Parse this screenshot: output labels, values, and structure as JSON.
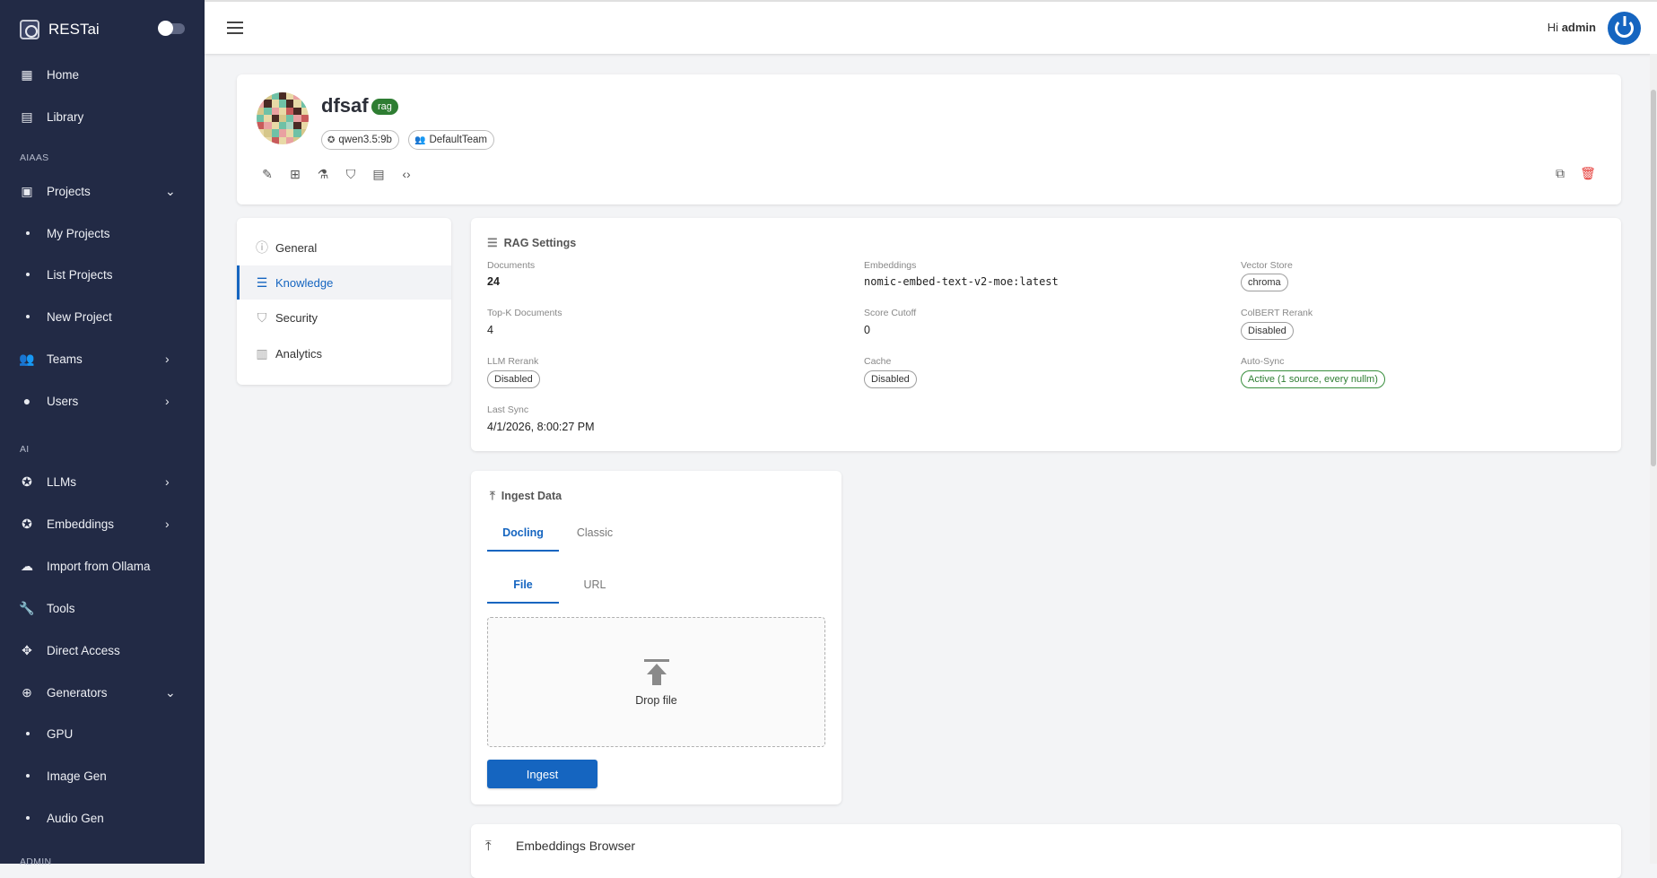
{
  "app": {
    "name": "RESTai"
  },
  "sidebar": {
    "items": [
      {
        "label": "Home",
        "icon": "dashboard-icon"
      },
      {
        "label": "Library",
        "icon": "library-icon"
      }
    ],
    "sections": {
      "aiaas": "AIAAS",
      "ai": "AI",
      "admin": "ADMIN"
    },
    "projects": {
      "label": "Projects",
      "sub": [
        "My Projects",
        "List Projects",
        "New Project"
      ]
    },
    "teams": "Teams",
    "users": "Users",
    "llms": "LLMs",
    "embeddings": "Embeddings",
    "import_ollama": "Import from Ollama",
    "tools": "Tools",
    "direct_access": "Direct Access",
    "generators": {
      "label": "Generators",
      "sub": [
        "GPU",
        "Image Gen",
        "Audio Gen"
      ]
    }
  },
  "topbar": {
    "greeting": "Hi",
    "user": "admin"
  },
  "project": {
    "name": "dfsaf",
    "type_badge": "rag",
    "llm": "qwen3.5:9b",
    "team": "DefaultTeam"
  },
  "tabs": [
    {
      "label": "General",
      "icon": "info-icon"
    },
    {
      "label": "Knowledge",
      "icon": "list-icon"
    },
    {
      "label": "Security",
      "icon": "shield-icon"
    },
    {
      "label": "Analytics",
      "icon": "bar-chart-icon"
    }
  ],
  "rag": {
    "title": "RAG Settings",
    "documents": {
      "label": "Documents",
      "value": "24"
    },
    "embeddings": {
      "label": "Embeddings",
      "value": "nomic-embed-text-v2-moe:latest"
    },
    "vector_store": {
      "label": "Vector Store",
      "value": "chroma"
    },
    "topk": {
      "label": "Top-K Documents",
      "value": "4"
    },
    "score_cutoff": {
      "label": "Score Cutoff",
      "value": "0"
    },
    "colbert": {
      "label": "ColBERT Rerank",
      "value": "Disabled"
    },
    "llm_rerank": {
      "label": "LLM Rerank",
      "value": "Disabled"
    },
    "cache": {
      "label": "Cache",
      "value": "Disabled"
    },
    "autosync": {
      "label": "Auto-Sync",
      "value": "Active (1 source, every nullm)"
    },
    "last_sync": {
      "label": "Last Sync",
      "value": "4/1/2026, 8:00:27 PM"
    }
  },
  "ingest": {
    "title": "Ingest Data",
    "tabs": [
      "Docling",
      "Classic"
    ],
    "subtabs": [
      "File",
      "URL"
    ],
    "drop_text": "Drop file",
    "button": "Ingest"
  },
  "embeddings_browser": {
    "title": "Embeddings Browser"
  },
  "colors": {
    "sidebar": "#222a45",
    "accent": "#1565c0",
    "badge_green": "#2e7d32",
    "delete": "#e53935"
  }
}
